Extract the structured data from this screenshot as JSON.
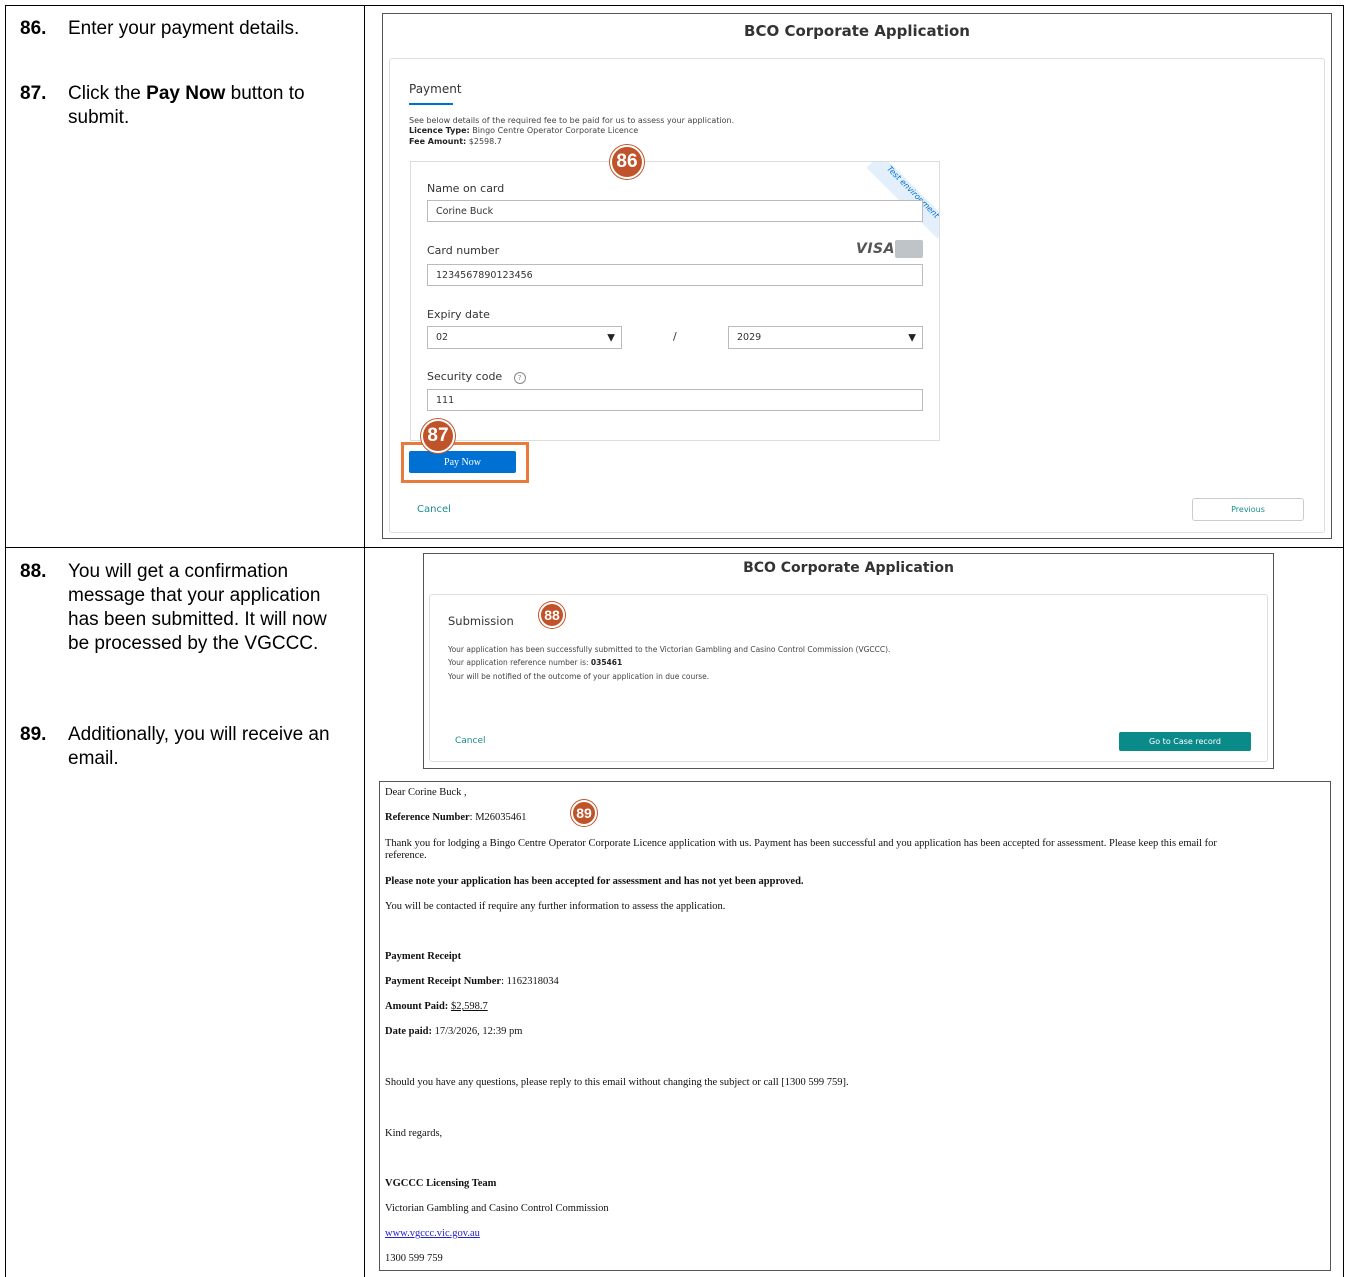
{
  "steps": [
    {
      "num": "86.",
      "text": "Enter your payment details."
    },
    {
      "num": "87.",
      "text_pre": "Click the ",
      "text_bold": "Pay Now",
      "text_post": " button to submit."
    },
    {
      "num": "88.",
      "text": "You will get a confirmation message that your application has been submitted. It will now be processed by the VGCCC."
    },
    {
      "num": "89.",
      "text": "Additionally, you will receive an email."
    }
  ],
  "payment_screen": {
    "app_title": "BCO Corporate Application",
    "tab_label": "Payment",
    "intro": "See below details of the required fee to be paid for us to assess your application.",
    "licence_type_label": "Licence Type:",
    "licence_type_value": "Bingo Centre Operator Corporate Licence",
    "fee_amount_label": "Fee Amount:",
    "fee_amount_value": "$2598.7",
    "badge_86": "86",
    "test_ribbon": "Test environment",
    "card_brand": "VISA",
    "name_label": "Name on card",
    "name_value": "Corine Buck",
    "card_number_label": "Card number",
    "card_number_value": "1234567890123456",
    "expiry_label": "Expiry date",
    "expiry_month": "02",
    "expiry_separator": "/",
    "expiry_year": "2029",
    "security_label": "Security code",
    "security_help": "?",
    "security_value": "111",
    "badge_87": "87",
    "pay_now": "Pay Now",
    "cancel": "Cancel",
    "previous": "Previous"
  },
  "submission_screen": {
    "app_title": "BCO Corporate Application",
    "tab_label": "Submission",
    "badge_88": "88",
    "line1": "Your application has been successfully submitted to the Victorian Gambling and Casino Control Commission (VGCCC).",
    "line2_pre": "Your application reference number is: ",
    "line2_ref": "035461",
    "line3": "Your will be notified of the outcome of your application in due course.",
    "cancel": "Cancel",
    "go_to_case": "Go to Case record"
  },
  "email": {
    "greeting": "Dear Corine Buck ,",
    "ref_label": "Reference Number",
    "ref_value": ": M26035461",
    "badge_89": "89",
    "para1_a": "Thank you for lodging a Bingo Centre Operator Corporate Licence application with us. Payment has been successful and you application has been accepted for assessment. Please keep this email for",
    "para1_b": "reference.",
    "note": "Please note your application has been accepted for assessment and has not yet been approved.",
    "contact": "You will be contacted if require any further information to assess the application.",
    "receipt_heading": "Payment Receipt",
    "receipt_num_label": "Payment Receipt Number",
    "receipt_num_value": ": 1162318034",
    "amount_label": "Amount Paid:",
    "amount_value": "$2,598.7",
    "date_label": "Date paid:",
    "date_value": " 17/3/2026, 12:39 pm",
    "questions": "Should you have any questions, please reply to this email without changing the subject or call [1300 599 759].",
    "regards": "Kind regards,",
    "team": "VGCCC Licensing Team",
    "org": "Victorian Gambling and Casino Control Commission",
    "website": "www.vgccc.vic.gov.au",
    "phone": "1300 599 759"
  },
  "colors": {
    "badge": "#c0532a",
    "highlight": "#e87a3c",
    "primary_blue": "#0070d2",
    "teal": "#0b8a8a"
  }
}
